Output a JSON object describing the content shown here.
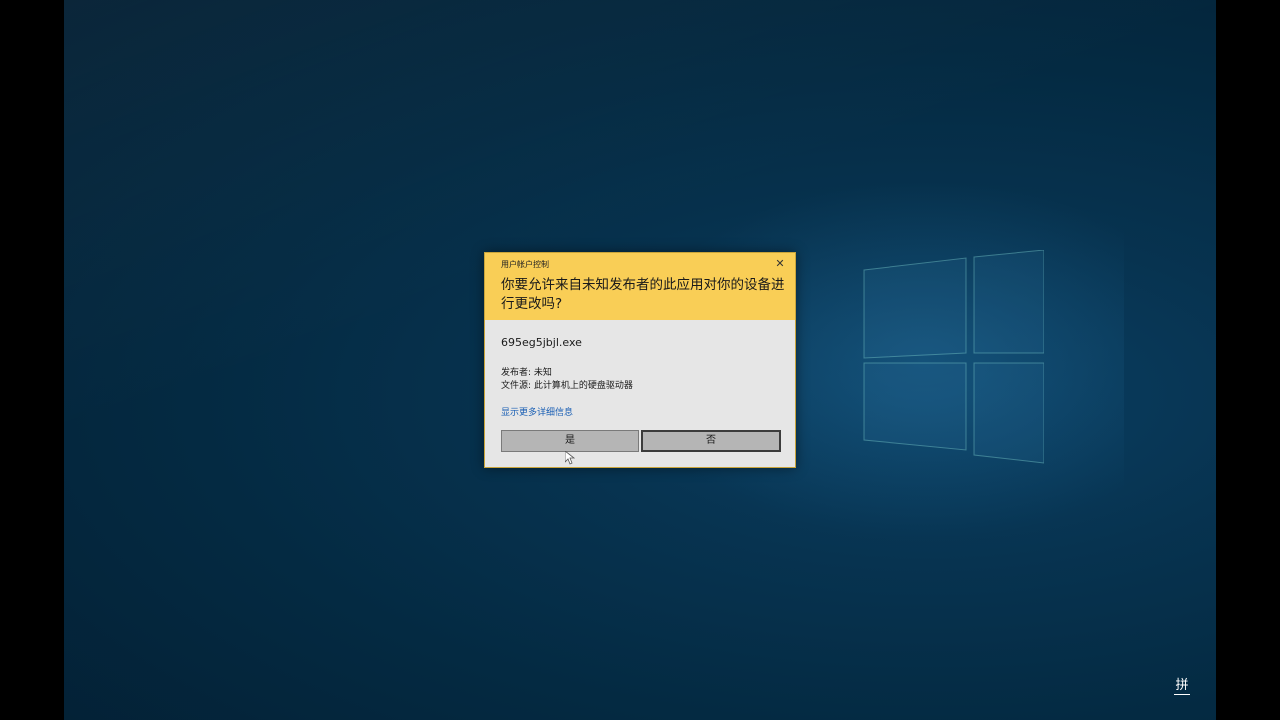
{
  "uac": {
    "caption": "用户帐户控制",
    "close_glyph": "✕",
    "question": "你要允许来自未知发布者的此应用对你的设备进行更改吗?",
    "filename": "695eg5jbjl.exe",
    "publisher": "发布者: 未知",
    "origin": "文件源: 此计算机上的硬盘驱动器",
    "details_link": "显示更多详细信息",
    "yes_label": "是",
    "no_label": "否"
  },
  "taskbar": {
    "ime_label": "拼"
  },
  "colors": {
    "header": "#f9ce56",
    "body": "#e6e6e6",
    "link": "#1a5fb4",
    "desktop": "#042a42"
  }
}
